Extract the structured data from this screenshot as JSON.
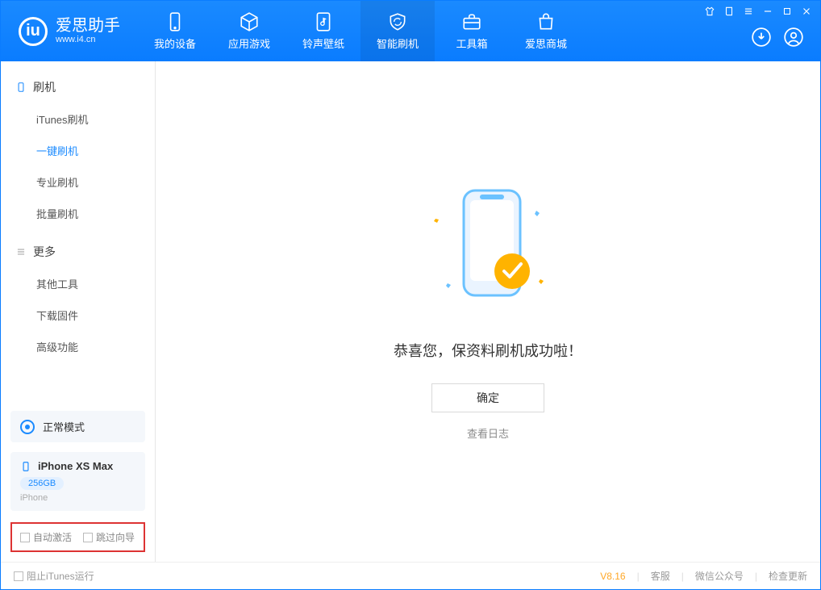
{
  "app": {
    "name_cn": "爱思助手",
    "name_en": "www.i4.cn"
  },
  "nav": {
    "device": "我的设备",
    "apps": "应用游戏",
    "ringtone": "铃声壁纸",
    "flash": "智能刷机",
    "toolbox": "工具箱",
    "store": "爱思商城"
  },
  "sidebar": {
    "section_flash": "刷机",
    "itunes_flash": "iTunes刷机",
    "one_key_flash": "一键刷机",
    "pro_flash": "专业刷机",
    "batch_flash": "批量刷机",
    "section_more": "更多",
    "other_tools": "其他工具",
    "download_fw": "下载固件",
    "advanced": "高级功能"
  },
  "mode": {
    "label": "正常模式"
  },
  "device": {
    "name": "iPhone XS Max",
    "capacity": "256GB",
    "type": "iPhone"
  },
  "checks": {
    "auto_activate": "自动激活",
    "skip_guide": "跳过向导"
  },
  "main": {
    "message": "恭喜您，保资料刷机成功啦！",
    "ok": "确定",
    "view_log": "查看日志"
  },
  "footer": {
    "block_itunes": "阻止iTunes运行",
    "version": "V8.16",
    "support": "客服",
    "wechat": "微信公众号",
    "check_update": "检查更新"
  }
}
